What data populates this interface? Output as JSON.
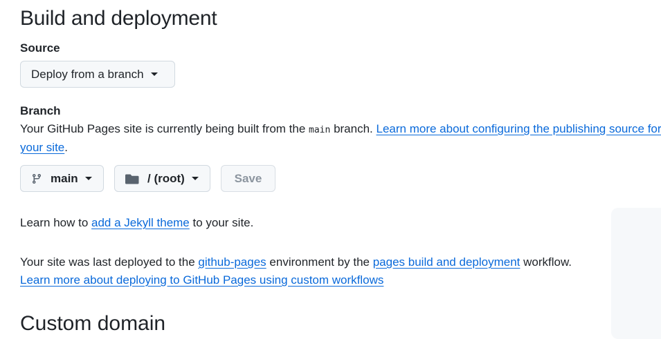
{
  "section": {
    "title": "Build and deployment"
  },
  "source": {
    "label": "Source",
    "dropdown_value": "Deploy from a branch"
  },
  "branch": {
    "label": "Branch",
    "desc_before": "Your GitHub Pages site is currently being built from the ",
    "branch_code": "main",
    "desc_after": " branch. ",
    "learn_link_line1": "Learn more about configuring the publishing source for",
    "learn_link_line2": "your site",
    "period": ".",
    "branch_select": "main",
    "folder_select": "/ (root)",
    "save_label": "Save"
  },
  "jekyll": {
    "before": "Learn how to ",
    "link": "add a Jekyll theme",
    "after": " to your site."
  },
  "deploy": {
    "text1": "Your site was last deployed to the ",
    "env_link": "github-pages",
    "text2": " environment by the ",
    "workflow_link": "pages build and deployment",
    "text3": " workflow.",
    "custom_link": "Learn more about deploying to GitHub Pages using custom workflows"
  },
  "custom_domain": {
    "title": "Custom domain"
  },
  "icons": {
    "branch": "git-branch-icon",
    "folder": "folder-icon",
    "caret": "triangle-down-icon"
  }
}
